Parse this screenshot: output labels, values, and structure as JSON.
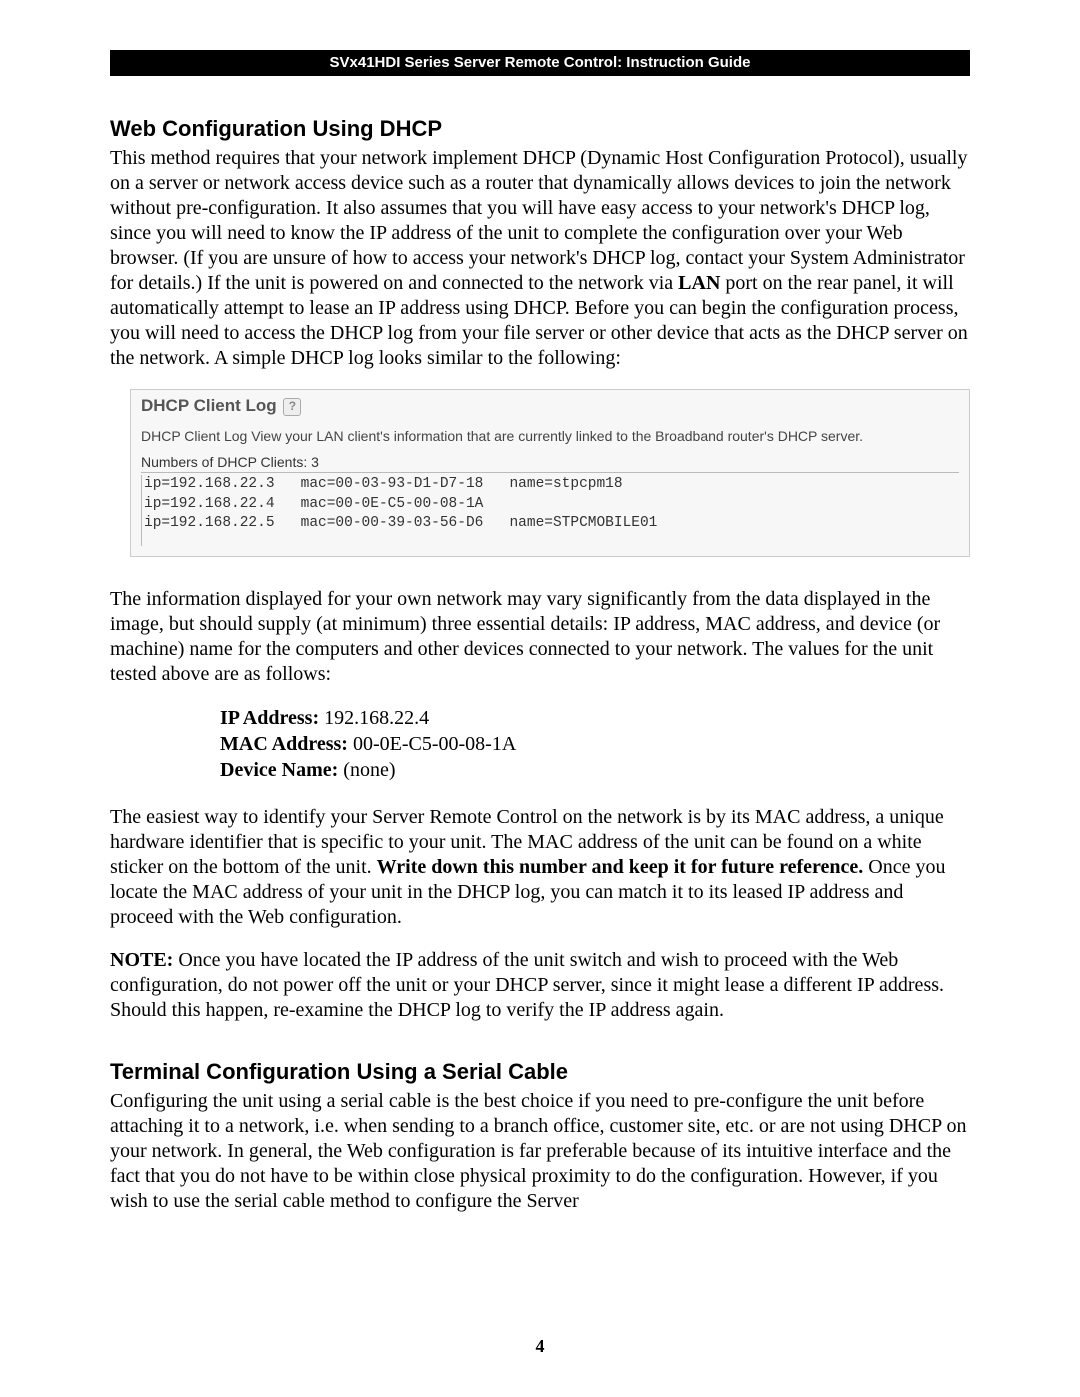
{
  "header": {
    "title": "SVx41HDI Series Server Remote Control: Instruction Guide"
  },
  "section1": {
    "heading": "Web Configuration Using DHCP",
    "para1_pre": "This method requires that your network implement DHCP (Dynamic Host Configuration Protocol), usually on a server or network access device such as a router that dynamically allows devices to join the network without pre-configuration.  It also assumes that you will have easy access to your network's DHCP log, since you will need to know the IP address of the unit to complete the configuration over your Web browser.  (If you are unsure of how to access your network's DHCP log, contact your System Administrator for details.)  If the unit is powered on and connected to the network via ",
    "para1_bold": "LAN",
    "para1_post": " port on the rear panel, it will automatically attempt to lease an IP address using DHCP.  Before you can begin the configuration process, you will need to access the DHCP log from your file server or other device that acts as the DHCP server on the network.  A simple DHCP log looks similar to the following:"
  },
  "dhcp": {
    "title": "DHCP Client Log",
    "desc": "DHCP Client Log View your LAN client's information that are currently linked to the Broadband router's DHCP server.",
    "count_label": "Numbers of DHCP Clients:  3",
    "rows": "ip=192.168.22.3   mac=00-03-93-D1-D7-18   name=stpcpm18\nip=192.168.22.4   mac=00-0E-C5-00-08-1A\nip=192.168.22.5   mac=00-00-39-03-56-D6   name=STPCMOBILE01"
  },
  "mid": {
    "para2": "The information displayed for your own network may vary significantly from the data displayed in the image, but should supply (at minimum) three essential details: IP address, MAC address, and device (or machine) name for the computers and other devices connected to your network.  The values for the unit tested above are as follows:",
    "kv": {
      "ip_label": "IP Address:",
      "ip_value": " 192.168.22.4",
      "mac_label": "MAC Address:",
      "mac_value": " 00-0E-C5-00-08-1A",
      "dev_label": "Device Name:",
      "dev_value": " (none)"
    },
    "para3_pre": "The easiest way to identify your Server Remote Control on the network is by its MAC address, a unique hardware identifier that is specific to your unit.  The MAC address of the unit can be found on a white sticker on the bottom of the unit.  ",
    "para3_bold": "Write down this number and keep it for future reference.",
    "para3_post": "  Once you locate the MAC address of your unit in the DHCP log, you can match it to its leased IP address and proceed with the Web configuration.",
    "note_label": "NOTE:",
    "note_body": " Once you have located the IP address of the unit switch and wish to proceed with the Web configuration, do not power off the unit or your DHCP server, since it might lease a different IP address.  Should this happen, re-examine the DHCP log to verify the IP address again."
  },
  "section2": {
    "heading": "Terminal Configuration Using a Serial Cable",
    "para": "Configuring the unit using a serial cable is the best choice if you need to pre-configure the unit before attaching it to a network, i.e. when sending to a branch office, customer site, etc. or are not using DHCP on your network.  In general, the Web configuration is far preferable because of its intuitive interface and the fact that you do not have to be within close physical proximity to do the configuration.  However, if you wish to use the serial cable method to configure the Server"
  },
  "page_number": "4"
}
